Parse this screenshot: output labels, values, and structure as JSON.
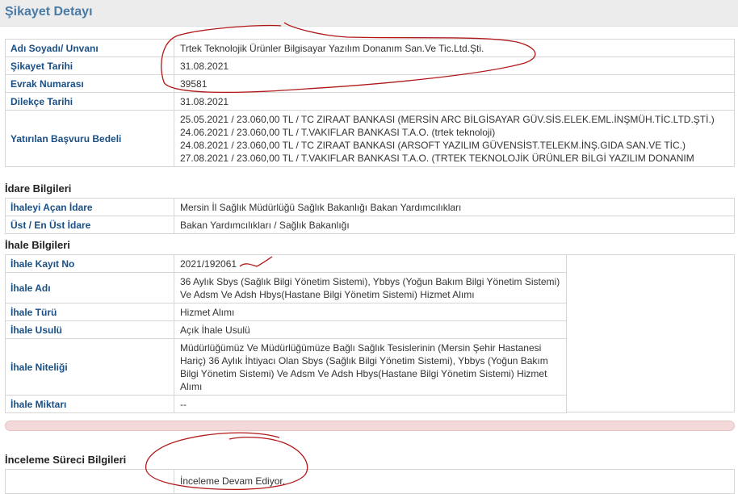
{
  "header": {
    "title": "Şikayet Detayı"
  },
  "complaint": {
    "rows": [
      {
        "label": "Adı Soyadı/ Unvanı",
        "value": "Trtek Teknolojik Ürünler Bilgisayar Yazılım Donanım San.Ve Tic.Ltd.Şti."
      },
      {
        "label": "Şikayet Tarihi",
        "value": "31.08.2021"
      },
      {
        "label": "Evrak Numarası",
        "value": "39581"
      },
      {
        "label": "Dilekçe Tarihi",
        "value": "31.08.2021"
      }
    ],
    "fee": {
      "label": "Yatırılan Başvuru Bedeli",
      "lines": [
        "25.05.2021 / 23.060,00 TL / TC ZIRAAT BANKASI (MERSİN ARC BİLGİSAYAR GÜV.SİS.ELEK.EML.İNŞMÜH.TİC.LTD.ŞTİ.)",
        "24.06.2021 / 23.060,00 TL / T.VAKIFLAR BANKASI T.A.O. (trtek teknoloji)",
        "24.08.2021 / 23.060,00 TL / TC ZIRAAT BANKASI (ARSOFT YAZILIM GÜVENSİST.TELEKM.İNŞ.GIDA SAN.VE TİC.)",
        "27.08.2021 / 23.060,00 TL / T.VAKIFLAR BANKASI T.A.O. (TRTEK TEKNOLOJİK ÜRÜNLER BİLGİ YAZILIM DONANIM"
      ]
    }
  },
  "admin": {
    "title": "İdare Bilgileri",
    "rows": [
      {
        "label": "İhaleyi Açan İdare",
        "value": "Mersin İl Sağlık Müdürlüğü Sağlık Bakanlığı Bakan Yardımcılıkları"
      },
      {
        "label": "Üst / En Üst İdare",
        "value": "Bakan Yardımcılıkları / Sağlık Bakanlığı"
      }
    ]
  },
  "tender": {
    "title": "İhale Bilgileri",
    "rows": [
      {
        "label": "İhale Kayıt No",
        "lines": [
          "2021/192061"
        ]
      },
      {
        "label": "İhale Adı",
        "lines": [
          "36 Aylık Sbys (Sağlık Bilgi Yönetim Sistemi), Ybbys (Yoğun Bakım Bilgi Yönetim Sistemi)",
          "Ve Adsm Ve Adsh Hbys(Hastane Bilgi Yönetim Sistemi) Hizmet Alımı"
        ]
      },
      {
        "label": "İhale Türü",
        "lines": [
          "Hizmet Alımı"
        ]
      },
      {
        "label": "İhale Usulü",
        "lines": [
          "Açık İhale Usulü"
        ]
      },
      {
        "label": "İhale Niteliği",
        "lines": [
          "Müdürlüğümüz Ve Müdürlüğümüze Bağlı Sağlık Tesislerinin (Mersin Şehir Hastanesi",
          "Hariç) 36 Aylık İhtiyacı Olan Sbys (Sağlık Bilgi Yönetim Sistemi), Ybbys (Yoğun Bakım",
          "Bilgi Yönetim Sistemi) Ve Adsm Ve Adsh Hbys(Hastane Bilgi Yönetim Sistemi) Hizmet",
          "Alımı"
        ]
      },
      {
        "label": "İhale Miktarı",
        "lines": [
          "--"
        ]
      }
    ]
  },
  "review": {
    "title": "İnceleme Süreci Bilgileri",
    "status": "İnceleme Devam Ediyor."
  },
  "colors": {
    "label": "#1a4f85",
    "header_title": "#4a7ba6",
    "annotation": "#b01818",
    "divider": "#f3d9d9"
  }
}
